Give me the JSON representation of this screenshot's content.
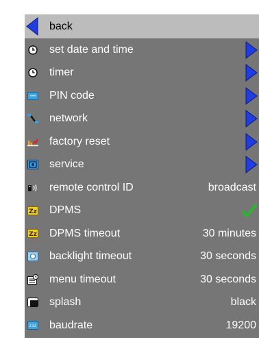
{
  "menu": {
    "back_label": "back",
    "items": [
      {
        "label": "set date and time",
        "icon": "clock-icon",
        "type": "submenu"
      },
      {
        "label": "timer",
        "icon": "timer-icon",
        "type": "submenu"
      },
      {
        "label": "PIN code",
        "icon": "pin-icon",
        "type": "submenu"
      },
      {
        "label": "network",
        "icon": "network-icon",
        "type": "submenu"
      },
      {
        "label": "factory reset",
        "icon": "factory-reset-icon",
        "type": "submenu"
      },
      {
        "label": "service",
        "icon": "service-icon",
        "type": "submenu"
      },
      {
        "label": "remote control ID",
        "icon": "remote-control-icon",
        "type": "value",
        "value": "broadcast"
      },
      {
        "label": "DPMS",
        "icon": "dpms-icon",
        "type": "check",
        "checked": true
      },
      {
        "label": "DPMS timeout",
        "icon": "dpms-timeout-icon",
        "type": "value",
        "value": "30 minutes"
      },
      {
        "label": "backlight timeout",
        "icon": "backlight-icon",
        "type": "value",
        "value": "30 seconds"
      },
      {
        "label": "menu timeout",
        "icon": "menu-timeout-icon",
        "type": "value",
        "value": "30 seconds"
      },
      {
        "label": "splash",
        "icon": "splash-icon",
        "type": "value",
        "value": "black"
      },
      {
        "label": "baudrate",
        "icon": "baudrate-icon",
        "type": "value",
        "value": "19200"
      }
    ]
  },
  "colors": {
    "panel": "#767676",
    "selected_row": "#bcbcbc",
    "arrow": "#1f3de0",
    "check": "#2bb52b"
  }
}
